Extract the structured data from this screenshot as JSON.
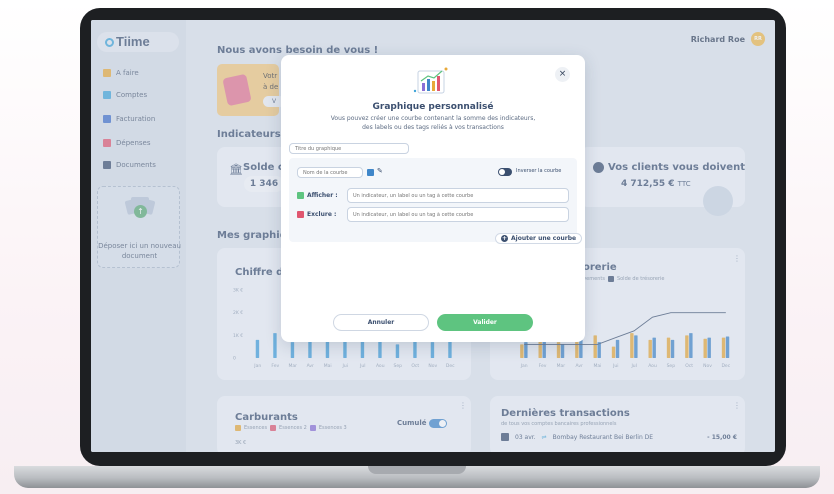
{
  "app": {
    "logo": "Tiime",
    "user_name": "Richard Roe",
    "user_initials": "RR"
  },
  "sidebar": {
    "items": [
      {
        "label": "A faire",
        "icon": "todo-icon",
        "color": "#e8a93a"
      },
      {
        "label": "Comptes",
        "icon": "bank-card-icon",
        "color": "#3fa5d9"
      },
      {
        "label": "Facturation",
        "icon": "invoice-icon",
        "color": "#3f6fc9"
      },
      {
        "label": "Dépenses",
        "icon": "expense-icon",
        "color": "#e0566f"
      },
      {
        "label": "Documents",
        "icon": "folder-icon",
        "color": "#3b4f6f"
      }
    ],
    "dropzone_text": "Déposer ici un nouveau document"
  },
  "main": {
    "help_title": "Nous avons besoin de vous !",
    "promo_line1": "Votr",
    "promo_line2": "à de",
    "promo_button": "V",
    "indicators_title": "Indicateurs",
    "balance_title": "Solde c",
    "balance_amount": "1 346",
    "clients_title": "Vos clients vous doivent",
    "clients_amount": "4 712,55 €",
    "clients_suffix": "TTC",
    "graphs_title": "Mes graphiqu",
    "chart1_title": "Chiffre d'",
    "chart2_title": "sorerie",
    "chart2_legend": [
      "ouvements",
      "Solde de trésorerie"
    ],
    "chart3_title": "Carburants",
    "chart3_toggle": "Cumulé",
    "chart3_legend": [
      "Essences",
      "Essences 2",
      "Essences 3"
    ],
    "chart3_ytick": "3K €",
    "tx_title": "Dernières transactions",
    "tx_sub": "de tous vos comptes bancaires professionnels",
    "tx_date": "03 avr.",
    "tx_label": "Bombay Restaurant Bei Berlin DE",
    "tx_amount": "- 15,00 €"
  },
  "modal": {
    "title": "Graphique personnalisé",
    "subtitle_line1": "Vous pouvez créer une courbe contenant la somme des indicateurs,",
    "subtitle_line2": "des labels ou des tags reliés à vos transactions",
    "chart_title_placeholder": "Titre du graphique",
    "curve_name_placeholder": "Nom de la courbe",
    "invert_label": "Inverser la courbe",
    "include_label": "Afficher :",
    "exclude_label": "Exclure :",
    "include_placeholder": "Un indicateur, un label ou un tag à cette courbe",
    "exclude_placeholder": "Un indicateur, un label ou un tag à cette courbe",
    "add_curve": "Ajouter une courbe",
    "cancel": "Annuler",
    "submit": "Valider",
    "close_glyph": "×"
  },
  "chart_data": [
    {
      "type": "bar",
      "categories": [
        "Jan",
        "Fev",
        "Mar",
        "Avr",
        "Mai",
        "Jui",
        "Jul",
        "Aou",
        "Sep",
        "Oct",
        "Nov",
        "Dec"
      ],
      "ytick_labels": [
        "3K €",
        "2K €",
        "1K €",
        "0"
      ],
      "ylim": [
        0,
        3000
      ],
      "series": [
        {
          "values": [
            800,
            1100,
            700,
            950,
            850,
            1000,
            750,
            900,
            600,
            800,
            700,
            900
          ],
          "color": "#3f9fdc"
        }
      ]
    },
    {
      "type": "bar",
      "categories": [
        "Jan",
        "Fev",
        "Mar",
        "Avr",
        "Mai",
        "Jui",
        "Jul",
        "Aou",
        "Sep",
        "Oct",
        "Nov",
        "Dec"
      ],
      "ylim": [
        0,
        3000
      ],
      "series": [
        {
          "values": [
            600,
            900,
            700,
            800,
            1000,
            500,
            1100,
            800,
            900,
            1000,
            850,
            900
          ],
          "color": "#e8a93a"
        },
        {
          "values": [
            700,
            800,
            600,
            900,
            700,
            800,
            1000,
            900,
            800,
            1100,
            900,
            950
          ],
          "color": "#3f86c9"
        }
      ],
      "line": {
        "name": "Solde de trésorerie",
        "values": [
          600,
          600,
          600,
          600,
          600,
          900,
          1200,
          1800,
          2000,
          2000,
          2000,
          2000
        ],
        "color": "#3b4f6f"
      }
    }
  ]
}
